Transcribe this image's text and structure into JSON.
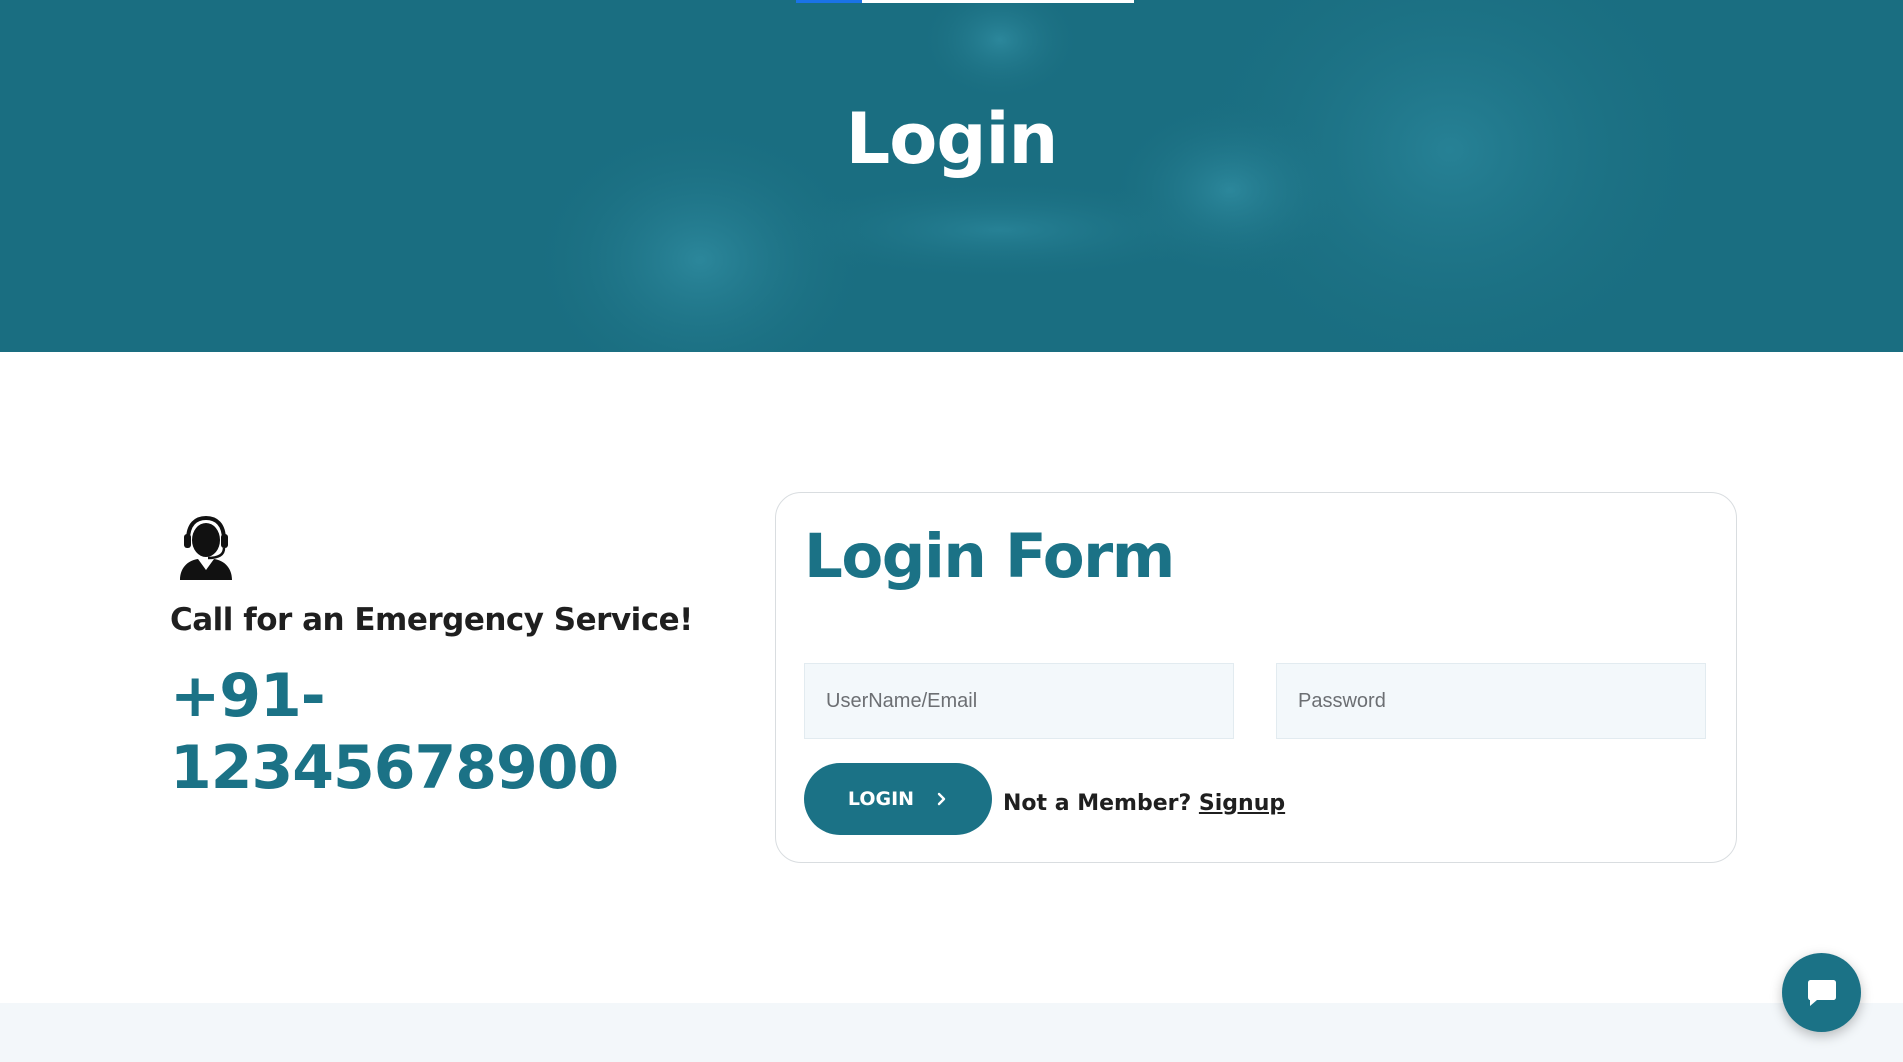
{
  "hero": {
    "title": "Login"
  },
  "contact": {
    "icon": "support-agent-icon",
    "text": "Call for an Emergency Service!",
    "phone": "+91-12345678900"
  },
  "login_form": {
    "title": "Login Form",
    "username_placeholder": "UserName/Email",
    "password_placeholder": "Password",
    "username_value": "",
    "password_value": "",
    "login_button": "LOGIN",
    "login_button_icon": "chevron-right-icon",
    "member_prompt": "Not a Member?",
    "signup_link": "Signup"
  },
  "chat": {
    "icon": "chat-bubble-icon"
  },
  "colors": {
    "brand": "#1b7286",
    "hero_bg": "#1d7184",
    "text_dark": "#1f1f1f",
    "field_bg": "#f3f8fb",
    "strip_bg": "#f3f7fa"
  }
}
